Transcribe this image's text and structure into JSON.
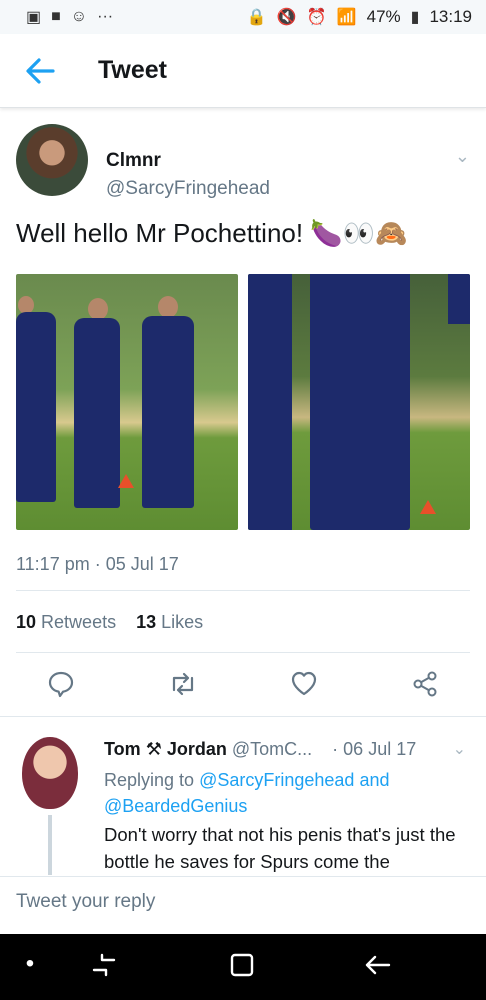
{
  "status_bar": {
    "left_icons": [
      "image-icon",
      "message-icon",
      "smiley-icon",
      "more-icon"
    ],
    "battery": "47%",
    "time": "13:19"
  },
  "header": {
    "title": "Tweet"
  },
  "tweet": {
    "author_name": "Clmnr",
    "author_handle": "@SarcyFringehead",
    "text": "Well hello Mr Pochettino! 🍆👀🙈",
    "timestamp": "11:17 pm · 05 Jul 17",
    "retweets_count": "10",
    "retweets_label": "Retweets",
    "likes_count": "13",
    "likes_label": "Likes"
  },
  "reply": {
    "name_part1": "Tom",
    "name_emoji": "⚒",
    "name_part2": "Jordan",
    "handle": "@TomC...",
    "date": "· 06 Jul 17",
    "replying_prefix": "Replying to",
    "replying_user1": "@SarcyFringehead",
    "replying_and": "and",
    "replying_user2": "@BeardedGenius",
    "text": "Don't worry that not his penis that's just the bottle he saves for Spurs come the"
  },
  "composer": {
    "placeholder": "Tweet your reply"
  }
}
